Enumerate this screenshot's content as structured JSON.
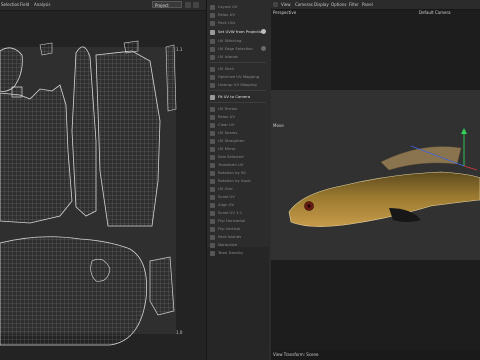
{
  "uv_editor": {
    "menu": [
      "Selection",
      "Field",
      "Analysis"
    ],
    "project_select": "Project",
    "uv_top_right_label": "1.1",
    "uv_bottom_right_label": "1.0"
  },
  "tool_panel": {
    "rows": [
      {
        "label": "Layout UV",
        "active": false
      },
      {
        "label": "Relax UV",
        "active": false
      },
      {
        "label": "Pack UVs",
        "active": false
      },
      {
        "label": "Set UVW from Projection",
        "active": true,
        "info": true
      },
      {
        "label": "UV Stitching",
        "active": false
      },
      {
        "label": "UV Edge Selection",
        "active": false
      },
      {
        "label": "UV Islands",
        "active": false
      },
      {
        "label": "UV Shell",
        "active": false
      },
      {
        "label": "Optimize UV Mapping",
        "active": false
      },
      {
        "label": "Unwrap UV Mapping",
        "active": false
      },
      {
        "label": "Fit UV to Camera",
        "active": true
      },
      {
        "label": "UV Terrain",
        "active": false
      },
      {
        "label": "Relax UV",
        "active": false
      },
      {
        "label": "Clear UV",
        "active": false
      },
      {
        "label": "UV Seams",
        "active": false
      },
      {
        "label": "UV Straighten",
        "active": false
      },
      {
        "label": "UV Mirror",
        "active": false
      },
      {
        "label": "Sew Selected",
        "active": false
      },
      {
        "label": "Transform UV",
        "active": false
      },
      {
        "label": "Rotation by 90",
        "active": false
      },
      {
        "label": "Rotation by Input",
        "active": false
      },
      {
        "label": "UV Grid",
        "active": false
      },
      {
        "label": "Scale UV",
        "active": false
      },
      {
        "label": "Align UV",
        "active": false
      },
      {
        "label": "Scale UV 1:1",
        "active": false
      },
      {
        "label": "Flip Horizontal",
        "active": false
      },
      {
        "label": "Flip Vertical",
        "active": false
      },
      {
        "label": "Pack Islands",
        "active": false
      },
      {
        "label": "Normalize",
        "active": false
      },
      {
        "label": "Texel Density",
        "active": false
      }
    ]
  },
  "viewport": {
    "menu": [
      "View",
      "Cameras",
      "Display",
      "Options",
      "Filter",
      "Panel"
    ],
    "perspective_label": "Perspective",
    "camera_label": "Default Camera",
    "move_label": "Move",
    "status_text": "View Transform: Scene"
  },
  "colors": {
    "panel_bg": "#2c2c2c",
    "uv_wire": "#cfcfcf",
    "gizmo_x": "#e03a3a",
    "gizmo_y": "#34d05a",
    "gizmo_z": "#3a63e0",
    "fish_body": "#8a6a2c"
  }
}
